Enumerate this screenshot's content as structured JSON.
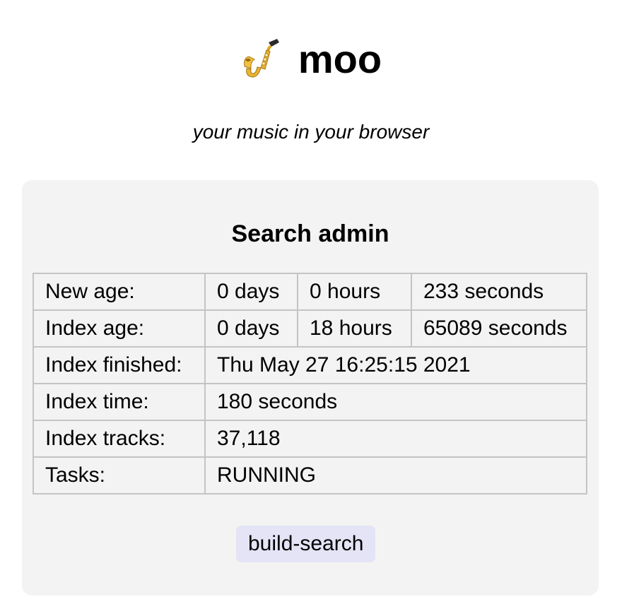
{
  "header": {
    "logo_icon": "saxophone-icon",
    "title": "moo",
    "tagline": "your music in your browser"
  },
  "card": {
    "title": "Search admin",
    "rows": [
      {
        "label": "New age:",
        "days": "0 days",
        "hours": "0 hours",
        "seconds": "233 seconds"
      },
      {
        "label": "Index age:",
        "days": "0 days",
        "hours": "18 hours",
        "seconds": "65089 seconds"
      },
      {
        "label": "Index finished:",
        "value": "Thu May 27 16:25:15 2021"
      },
      {
        "label": "Index time:",
        "value": "180 seconds"
      },
      {
        "label": "Index tracks:",
        "value": "37,118"
      },
      {
        "label": "Tasks:",
        "value": "RUNNING"
      }
    ],
    "button_label": "build-search"
  },
  "colors": {
    "card_background": "#f3f3f3",
    "table_border": "#c4c4c4",
    "button_background": "#e4e4f6"
  }
}
